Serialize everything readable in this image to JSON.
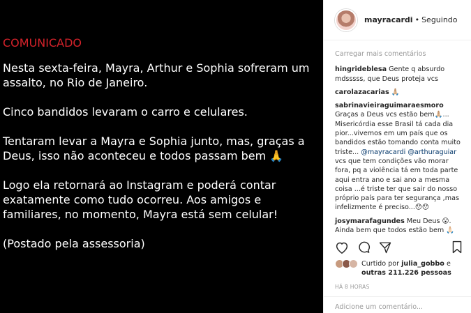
{
  "post": {
    "heading": "COMUNICADO",
    "paragraphs": [
      "Nesta sexta-feira,  Mayra, Arthur e Sophia sofreram um\nassalto,  no Rio de Janeiro.",
      "Cinco bandidos levaram o carro e celulares.",
      "Tentaram levar a Mayra e Sophia junto, mas, graças a\nDeus, isso não aconteceu  e todos passam bem 🙏",
      "Logo ela retornará ao Instagram e poderá contar\nexatamente como tudo ocorreu. Aos amigos e\nfamiliares, no momento,  Mayra está sem celular!",
      "(Postado pela assessoria)"
    ]
  },
  "header": {
    "username": "mayracardi",
    "separator": "•",
    "follow_status": "Seguindo"
  },
  "comments": {
    "load_more": "Carregar mais comentários",
    "items": [
      {
        "author": "hingrideblesa",
        "text": " Gente q absurdo mdsssss, que Deus proteja vcs"
      },
      {
        "author": "carolazacarias",
        "text": " 🙏🏼"
      },
      {
        "author": "sabrinavieiraguimaraesmoro",
        "text": " Graças a Deus vcs estão bem🙏🏼... Misericórdia esse Brasil tá cada dia pior...vivemos em um país que os bandidos estão tomando conta muito triste... ",
        "mention1": "@mayracardi",
        "mention2": "@arthuraguiar",
        "text2": " vcs que tem condições vão morar fora, pq a violência tá em toda parte aqui entra ano e sai ano a mesma coisa ...é triste ter que sair do nosso próprio país para ter segurança ,mas infelizmente é preciso...😯😯"
      },
      {
        "author": "josymarafagundes",
        "text": " Meu Deus 😮. Ainda bem que todos estão bem 🙏🏻"
      }
    ]
  },
  "likes": {
    "prefix": "Curtido por ",
    "user": "julia_gobbo",
    "middle": " e",
    "others": "outras 211.226 pessoas"
  },
  "time": "HÁ 8 HORAS",
  "add_comment": {
    "placeholder": "Adicione um comentário..."
  },
  "colors": {
    "heading": "#d3222a",
    "mention": "#003569",
    "muted": "#999999"
  }
}
